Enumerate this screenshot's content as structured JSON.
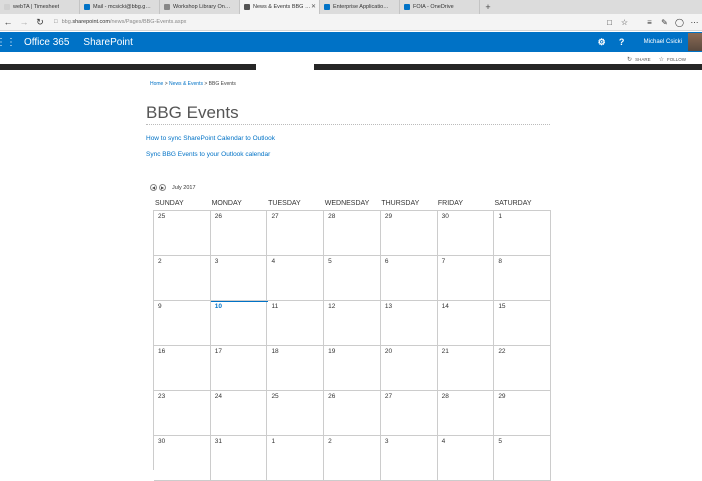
{
  "browser": {
    "tabs": [
      {
        "label": "webTA | Timesheet",
        "color": "#d0d0d0",
        "active": false
      },
      {
        "label": "Mail - mcsicki@bbg.gov",
        "color": "#0072c6",
        "active": false
      },
      {
        "label": "Workshop Library On-Dema",
        "color": "#888888",
        "active": false
      },
      {
        "label": "News & Events BBG Eve",
        "color": "#555555",
        "active": true
      },
      {
        "label": "Enterprise Applications Lim",
        "color": "#0072c6",
        "active": false
      },
      {
        "label": "FOIA - OneDrive",
        "color": "#0072c6",
        "active": false
      }
    ],
    "url_domain_prefix": "bbg.",
    "url_domain": "sharepoint.com",
    "url_path": "/news/Pages/BBG-Events.aspx"
  },
  "suitebar": {
    "brand": "Office 365",
    "app": "SharePoint",
    "user": "Michael Csicki",
    "accent": "#0072c6"
  },
  "actions": {
    "share": "SHARE",
    "follow": "FOLLOW"
  },
  "breadcrumb": {
    "home": "Home",
    "sep1": " > ",
    "news": "News & Events",
    "sep2": " > ",
    "current": "BBG Events"
  },
  "page": {
    "title": "BBG Events",
    "link1": "How to sync SharePoint Calendar to Outlook",
    "link2": "Sync BBG Events to your Outlook calendar"
  },
  "calendar": {
    "month_label": "July 2017",
    "days_of_week": [
      "SUNDAY",
      "MONDAY",
      "TUESDAY",
      "WEDNESDAY",
      "THURSDAY",
      "FRIDAY",
      "SATURDAY"
    ],
    "weeks": [
      [
        "25",
        "26",
        "27",
        "28",
        "29",
        "30",
        "1"
      ],
      [
        "2",
        "3",
        "4",
        "5",
        "6",
        "7",
        "8"
      ],
      [
        "9",
        "10",
        "11",
        "12",
        "13",
        "14",
        "15"
      ],
      [
        "16",
        "17",
        "18",
        "19",
        "20",
        "21",
        "22"
      ],
      [
        "23",
        "24",
        "25",
        "26",
        "27",
        "28",
        "29"
      ],
      [
        "30",
        "31",
        "1",
        "2",
        "3",
        "4",
        "5"
      ]
    ],
    "today": "10"
  }
}
